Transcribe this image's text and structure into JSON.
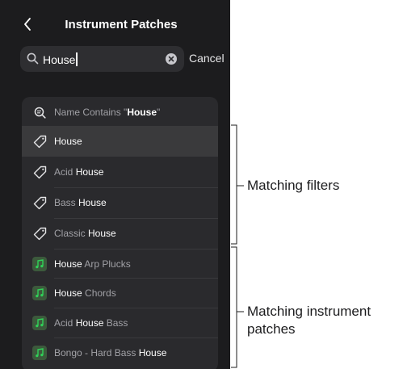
{
  "header": {
    "back_icon": "chevron-left-icon",
    "title": "Instrument Patches"
  },
  "search": {
    "icon": "search-icon",
    "value": "House",
    "clear_icon": "clear-circle-icon",
    "cancel_label": "Cancel"
  },
  "results": [
    {
      "icon": "search-text-icon",
      "kind": "query",
      "pre": "Name Contains \"",
      "hl": "House",
      "post": "\"",
      "selected": false
    },
    {
      "icon": "tag-icon",
      "kind": "filter",
      "pre": "",
      "hl": "House",
      "post": "",
      "selected": true
    },
    {
      "icon": "tag-icon",
      "kind": "filter",
      "pre": "Acid ",
      "hl": "House",
      "post": "",
      "selected": false
    },
    {
      "icon": "tag-icon",
      "kind": "filter",
      "pre": "Bass ",
      "hl": "House",
      "post": "",
      "selected": false
    },
    {
      "icon": "tag-icon",
      "kind": "filter",
      "pre": "Classic ",
      "hl": "House",
      "post": "",
      "selected": false
    },
    {
      "icon": "music-note-icon",
      "kind": "patch",
      "pre": "",
      "hl": "House",
      "post": " Arp Plucks",
      "selected": false
    },
    {
      "icon": "music-note-icon",
      "kind": "patch",
      "pre": "",
      "hl": "House",
      "post": " Chords",
      "selected": false
    },
    {
      "icon": "music-note-icon",
      "kind": "patch",
      "pre": "Acid ",
      "hl": "House",
      "post": " Bass",
      "selected": false
    },
    {
      "icon": "music-note-icon",
      "kind": "patch",
      "pre": "Bongo - Hard Bass ",
      "hl": "House",
      "post": "",
      "selected": false
    }
  ],
  "annotations": {
    "filters": "Matching filters",
    "patches_line1": "Matching instrument",
    "patches_line2": "patches"
  },
  "colors": {
    "panel_bg": "#1c1c1e",
    "list_bg": "#2a2a2d",
    "selected_row": "#3a3a3c",
    "patch_icon_bg": "#3c5a3c",
    "patch_note": "#30d158"
  }
}
